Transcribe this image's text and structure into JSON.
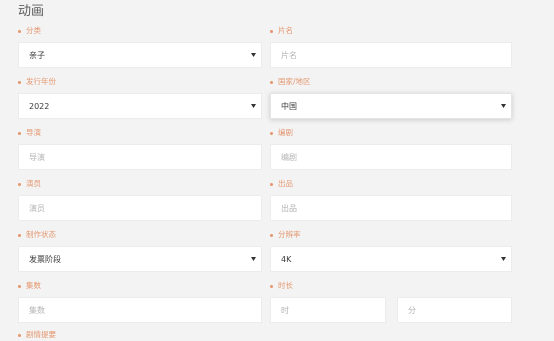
{
  "page": {
    "title": "动画"
  },
  "form": {
    "category": {
      "label": "分类",
      "value": "亲子"
    },
    "film_title": {
      "label": "片名",
      "placeholder": "片名"
    },
    "release_year": {
      "label": "发行年份",
      "value": "2022"
    },
    "country": {
      "label": "国家/地区",
      "value": "中国"
    },
    "director": {
      "label": "导演",
      "placeholder": "导演"
    },
    "writer": {
      "label": "编剧",
      "placeholder": "编剧"
    },
    "actors": {
      "label": "演员",
      "placeholder": "演员"
    },
    "producer": {
      "label": "出品",
      "placeholder": "出品"
    },
    "status": {
      "label": "制作状态",
      "value": "发票阶段"
    },
    "resolution": {
      "label": "分辨率",
      "value": "4K"
    },
    "episodes": {
      "label": "集数",
      "placeholder": "集数"
    },
    "duration": {
      "label": "时长",
      "hours_placeholder": "时",
      "minutes_placeholder": "分"
    },
    "synopsis": {
      "label": "剧情提要"
    }
  },
  "icons": {
    "select_arrow": "chevron-down-icon",
    "required_marker": "required-dot-icon"
  },
  "colors": {
    "background": "#f3f3f3",
    "label": "#e3976f",
    "required_dot": "#e3976f",
    "field_bg": "#ffffff",
    "field_border": "#ececec",
    "value_text": "#3a3a3a",
    "placeholder_text": "#b3b3b3",
    "title": "#5c5c5c",
    "arrow": "#333333"
  }
}
